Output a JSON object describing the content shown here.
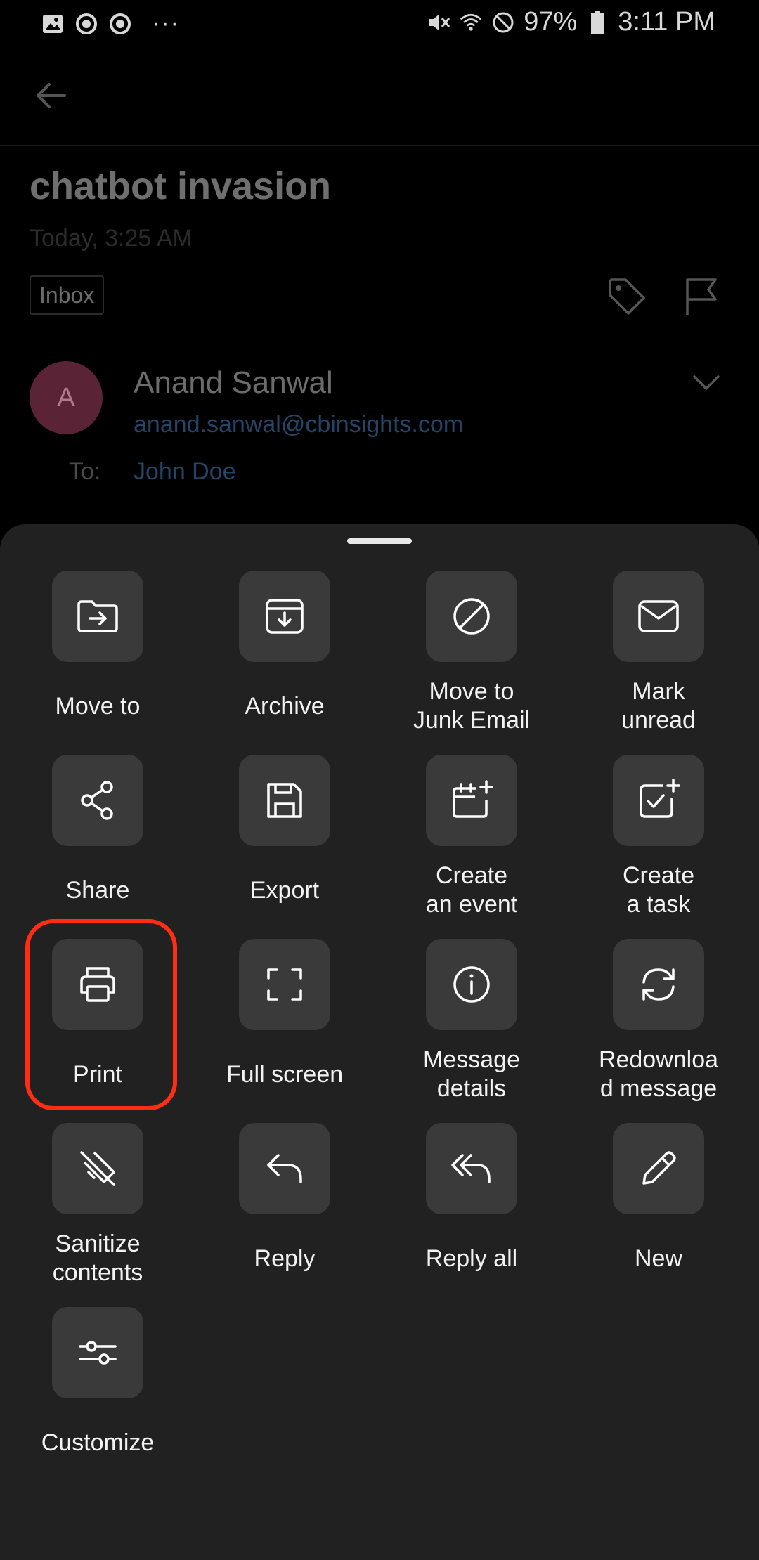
{
  "status_bar": {
    "battery": "97%",
    "time": "3:11 PM",
    "notification_more": "···"
  },
  "email": {
    "subject": "chatbot invasion",
    "date": "Today, 3:25 AM",
    "folder_tag": "Inbox",
    "avatar_initial": "A",
    "sender_name": "Anand Sanwal",
    "sender_email": "anand.sanwal@cbinsights.com",
    "to_label": "To:",
    "to_value": "John Doe"
  },
  "actions": [
    {
      "label": "Move to",
      "icon": "folder-move-icon"
    },
    {
      "label": "Archive",
      "icon": "archive-icon"
    },
    {
      "label": "Move to\nJunk Email",
      "icon": "block-icon"
    },
    {
      "label": "Mark\nunread",
      "icon": "envelope-icon"
    },
    {
      "label": "Share",
      "icon": "share-icon"
    },
    {
      "label": "Export",
      "icon": "save-icon"
    },
    {
      "label": "Create\nan event",
      "icon": "calendar-add-icon"
    },
    {
      "label": "Create\na task",
      "icon": "task-add-icon"
    },
    {
      "label": "Print",
      "icon": "printer-icon"
    },
    {
      "label": "Full screen",
      "icon": "fullscreen-icon"
    },
    {
      "label": "Message\ndetails",
      "icon": "info-icon"
    },
    {
      "label": "Redownloa\nd message",
      "icon": "refresh-icon"
    },
    {
      "label": "Sanitize\ncontents",
      "icon": "sanitize-icon"
    },
    {
      "label": "Reply",
      "icon": "reply-icon"
    },
    {
      "label": "Reply all",
      "icon": "reply-all-icon"
    },
    {
      "label": "New",
      "icon": "pencil-icon"
    },
    {
      "label": "Customize",
      "icon": "sliders-icon"
    }
  ],
  "colors": {
    "sheet_bg": "#212121",
    "tile_bg": "#3a3a3a",
    "highlight": "#ff2d14",
    "link": "#244566"
  }
}
